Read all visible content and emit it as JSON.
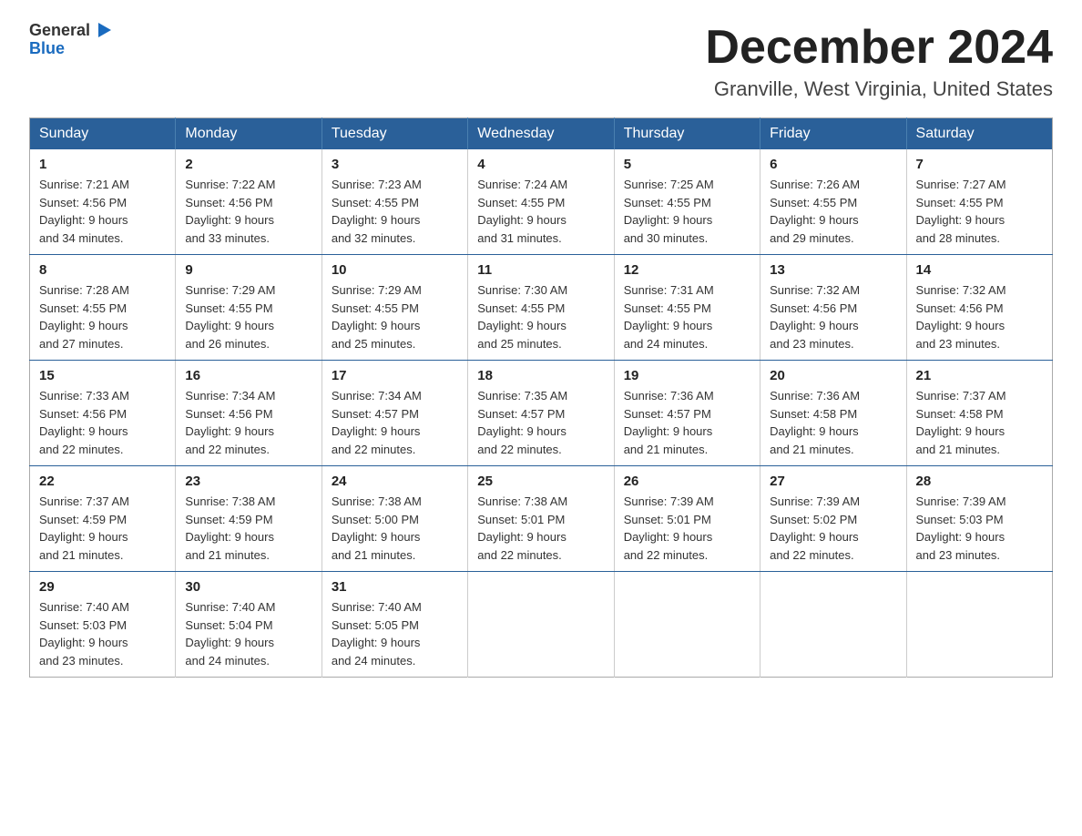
{
  "header": {
    "logo_general": "General",
    "logo_blue": "Blue",
    "month_title": "December 2024",
    "location": "Granville, West Virginia, United States"
  },
  "weekdays": [
    "Sunday",
    "Monday",
    "Tuesday",
    "Wednesday",
    "Thursday",
    "Friday",
    "Saturday"
  ],
  "weeks": [
    [
      {
        "day": "1",
        "sunrise": "7:21 AM",
        "sunset": "4:56 PM",
        "daylight": "9 hours and 34 minutes."
      },
      {
        "day": "2",
        "sunrise": "7:22 AM",
        "sunset": "4:56 PM",
        "daylight": "9 hours and 33 minutes."
      },
      {
        "day": "3",
        "sunrise": "7:23 AM",
        "sunset": "4:55 PM",
        "daylight": "9 hours and 32 minutes."
      },
      {
        "day": "4",
        "sunrise": "7:24 AM",
        "sunset": "4:55 PM",
        "daylight": "9 hours and 31 minutes."
      },
      {
        "day": "5",
        "sunrise": "7:25 AM",
        "sunset": "4:55 PM",
        "daylight": "9 hours and 30 minutes."
      },
      {
        "day": "6",
        "sunrise": "7:26 AM",
        "sunset": "4:55 PM",
        "daylight": "9 hours and 29 minutes."
      },
      {
        "day": "7",
        "sunrise": "7:27 AM",
        "sunset": "4:55 PM",
        "daylight": "9 hours and 28 minutes."
      }
    ],
    [
      {
        "day": "8",
        "sunrise": "7:28 AM",
        "sunset": "4:55 PM",
        "daylight": "9 hours and 27 minutes."
      },
      {
        "day": "9",
        "sunrise": "7:29 AM",
        "sunset": "4:55 PM",
        "daylight": "9 hours and 26 minutes."
      },
      {
        "day": "10",
        "sunrise": "7:29 AM",
        "sunset": "4:55 PM",
        "daylight": "9 hours and 25 minutes."
      },
      {
        "day": "11",
        "sunrise": "7:30 AM",
        "sunset": "4:55 PM",
        "daylight": "9 hours and 25 minutes."
      },
      {
        "day": "12",
        "sunrise": "7:31 AM",
        "sunset": "4:55 PM",
        "daylight": "9 hours and 24 minutes."
      },
      {
        "day": "13",
        "sunrise": "7:32 AM",
        "sunset": "4:56 PM",
        "daylight": "9 hours and 23 minutes."
      },
      {
        "day": "14",
        "sunrise": "7:32 AM",
        "sunset": "4:56 PM",
        "daylight": "9 hours and 23 minutes."
      }
    ],
    [
      {
        "day": "15",
        "sunrise": "7:33 AM",
        "sunset": "4:56 PM",
        "daylight": "9 hours and 22 minutes."
      },
      {
        "day": "16",
        "sunrise": "7:34 AM",
        "sunset": "4:56 PM",
        "daylight": "9 hours and 22 minutes."
      },
      {
        "day": "17",
        "sunrise": "7:34 AM",
        "sunset": "4:57 PM",
        "daylight": "9 hours and 22 minutes."
      },
      {
        "day": "18",
        "sunrise": "7:35 AM",
        "sunset": "4:57 PM",
        "daylight": "9 hours and 22 minutes."
      },
      {
        "day": "19",
        "sunrise": "7:36 AM",
        "sunset": "4:57 PM",
        "daylight": "9 hours and 21 minutes."
      },
      {
        "day": "20",
        "sunrise": "7:36 AM",
        "sunset": "4:58 PM",
        "daylight": "9 hours and 21 minutes."
      },
      {
        "day": "21",
        "sunrise": "7:37 AM",
        "sunset": "4:58 PM",
        "daylight": "9 hours and 21 minutes."
      }
    ],
    [
      {
        "day": "22",
        "sunrise": "7:37 AM",
        "sunset": "4:59 PM",
        "daylight": "9 hours and 21 minutes."
      },
      {
        "day": "23",
        "sunrise": "7:38 AM",
        "sunset": "4:59 PM",
        "daylight": "9 hours and 21 minutes."
      },
      {
        "day": "24",
        "sunrise": "7:38 AM",
        "sunset": "5:00 PM",
        "daylight": "9 hours and 21 minutes."
      },
      {
        "day": "25",
        "sunrise": "7:38 AM",
        "sunset": "5:01 PM",
        "daylight": "9 hours and 22 minutes."
      },
      {
        "day": "26",
        "sunrise": "7:39 AM",
        "sunset": "5:01 PM",
        "daylight": "9 hours and 22 minutes."
      },
      {
        "day": "27",
        "sunrise": "7:39 AM",
        "sunset": "5:02 PM",
        "daylight": "9 hours and 22 minutes."
      },
      {
        "day": "28",
        "sunrise": "7:39 AM",
        "sunset": "5:03 PM",
        "daylight": "9 hours and 23 minutes."
      }
    ],
    [
      {
        "day": "29",
        "sunrise": "7:40 AM",
        "sunset": "5:03 PM",
        "daylight": "9 hours and 23 minutes."
      },
      {
        "day": "30",
        "sunrise": "7:40 AM",
        "sunset": "5:04 PM",
        "daylight": "9 hours and 24 minutes."
      },
      {
        "day": "31",
        "sunrise": "7:40 AM",
        "sunset": "5:05 PM",
        "daylight": "9 hours and 24 minutes."
      },
      null,
      null,
      null,
      null
    ]
  ],
  "labels": {
    "sunrise": "Sunrise:",
    "sunset": "Sunset:",
    "daylight": "Daylight:"
  }
}
